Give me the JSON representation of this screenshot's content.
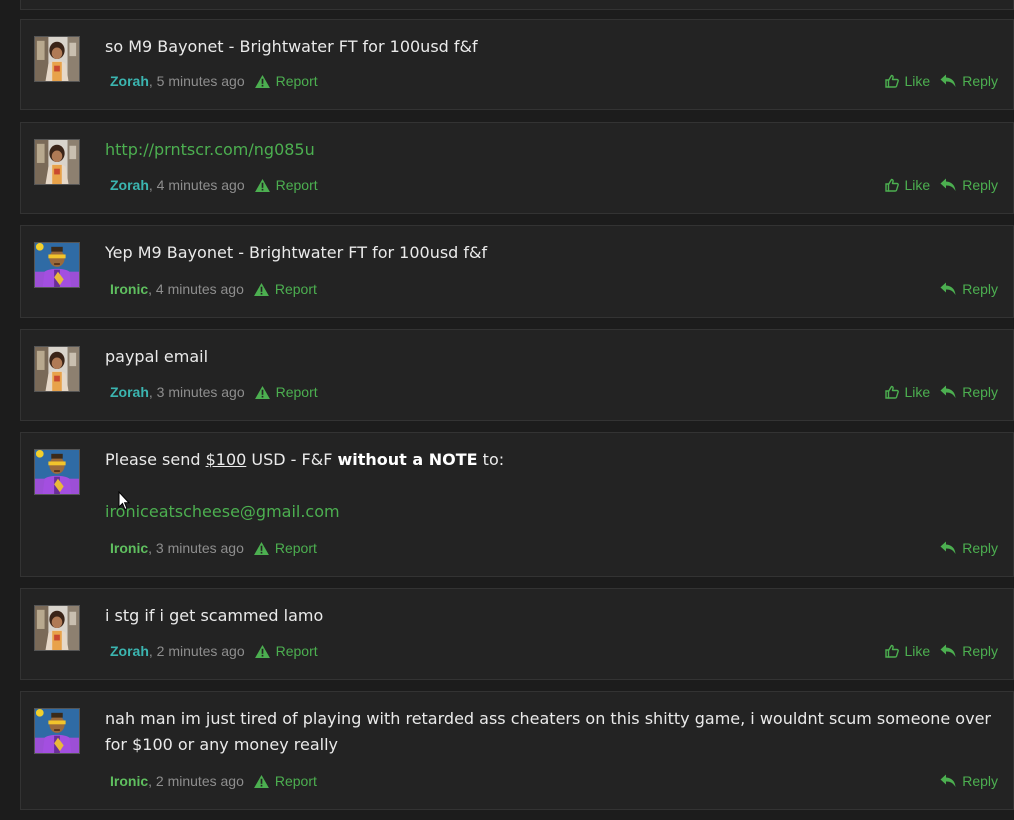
{
  "posts": [
    {
      "user": "Zorah",
      "time": ", 5 minutes ago",
      "report": "Report",
      "like": "Like",
      "reply": "Reply",
      "text": "so M9 Bayonet - Brightwater FT for 100usd f&f"
    },
    {
      "user": "Zorah",
      "time": ", 4 minutes ago",
      "report": "Report",
      "like": "Like",
      "reply": "Reply",
      "link": "http://prntscr.com/ng085u"
    },
    {
      "user": "Ironic",
      "time": ", 4 minutes ago",
      "report": "Report",
      "reply": "Reply",
      "text": "Yep M9 Bayonet - Brightwater FT for 100usd f&f"
    },
    {
      "user": "Zorah",
      "time": ", 3 minutes ago",
      "report": "Report",
      "like": "Like",
      "reply": "Reply",
      "text": "paypal email"
    },
    {
      "user": "Ironic",
      "time": ", 3 minutes ago",
      "report": "Report",
      "reply": "Reply",
      "line1_a": "Please send ",
      "line1_amount": "$100",
      "line1_b": " USD - F&F ",
      "line1_bold": "without a NOTE",
      "line1_c": " to:",
      "email": "ironiceatscheese@gmail.com"
    },
    {
      "user": "Zorah",
      "time": ", 2 minutes ago",
      "report": "Report",
      "like": "Like",
      "reply": "Reply",
      "text": "i stg if i get scammed lamo"
    },
    {
      "user": "Ironic",
      "time": ", 2 minutes ago",
      "report": "Report",
      "reply": "Reply",
      "text": "nah man im just tired of playing with retarded ass cheaters on this shitty game, i wouldnt scum someone over for $100 or any money really"
    }
  ],
  "colors": {
    "accent": "#4caf50",
    "zorah": "#3bb5b0",
    "ironic": "#5fbf5f",
    "background": "#1c1c1c",
    "panel": "#232323"
  },
  "icons": {
    "report": "warning-triangle-icon",
    "like": "thumbs-up-icon",
    "reply": "reply-arrow-icon"
  }
}
